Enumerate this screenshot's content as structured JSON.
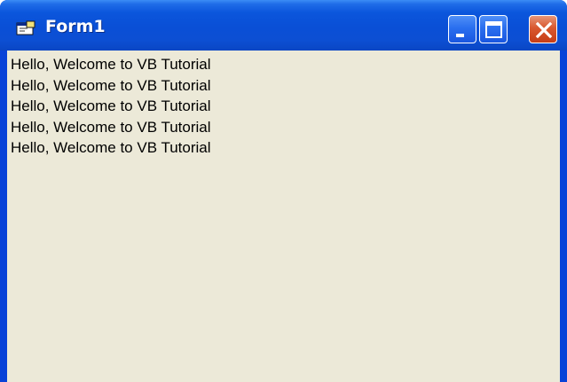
{
  "window": {
    "title": "Form1",
    "icon": "vb-form-icon",
    "controls": {
      "minimize": "minimize-icon",
      "maximize": "maximize-icon",
      "close": "close-icon"
    },
    "colors": {
      "titlebar": "#0a4fd6",
      "client_background": "#ece9d8",
      "close_button": "#d9582f"
    }
  },
  "content": {
    "lines": [
      "Hello, Welcome to VB Tutorial",
      "Hello, Welcome to VB Tutorial",
      "Hello, Welcome to VB Tutorial",
      "Hello, Welcome to VB Tutorial",
      "Hello, Welcome to VB Tutorial"
    ]
  }
}
